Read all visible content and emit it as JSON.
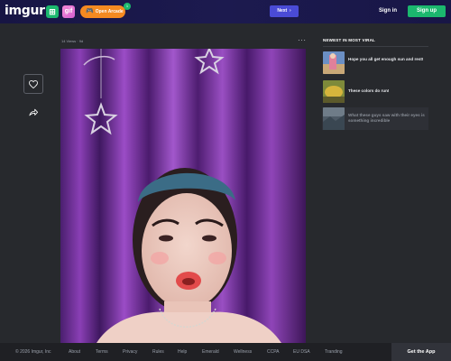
{
  "header": {
    "logo": "imgur",
    "upload_icon": "plus-icon",
    "gif_label": "gif",
    "arcade_label": "Open Arcade",
    "arcade_badge": "1",
    "next_label": "Next",
    "signin_label": "Sign in",
    "signup_label": "Sign up"
  },
  "post": {
    "meta": "14 Views · 9d",
    "more_label": "···"
  },
  "side_actions": [
    {
      "icon": "heart-icon"
    },
    {
      "icon": "share-arrow-icon"
    }
  ],
  "viral": {
    "title": "NEWEST IN MOST VIRAL",
    "items": [
      {
        "text": "Hope you all get enough sun and rest!"
      },
      {
        "text": "These colors do run!"
      },
      {
        "text": "What these guys saw with their eyes is something incredible"
      }
    ]
  },
  "footer": {
    "links": [
      "© 2026 Imgur, Inc",
      "About",
      "Terms",
      "Privacy",
      "Rules",
      "Help",
      "Emerald",
      "Wellness",
      "CCPA",
      "EU DSA",
      "Tranding"
    ],
    "get_app": "Get the App"
  },
  "colors": {
    "header_bg": "#1a184a",
    "page_bg": "#27292d",
    "accent_green": "#1bb76e",
    "next_blue": "#4a4bd6",
    "arcade_orange": "#f58a21"
  }
}
